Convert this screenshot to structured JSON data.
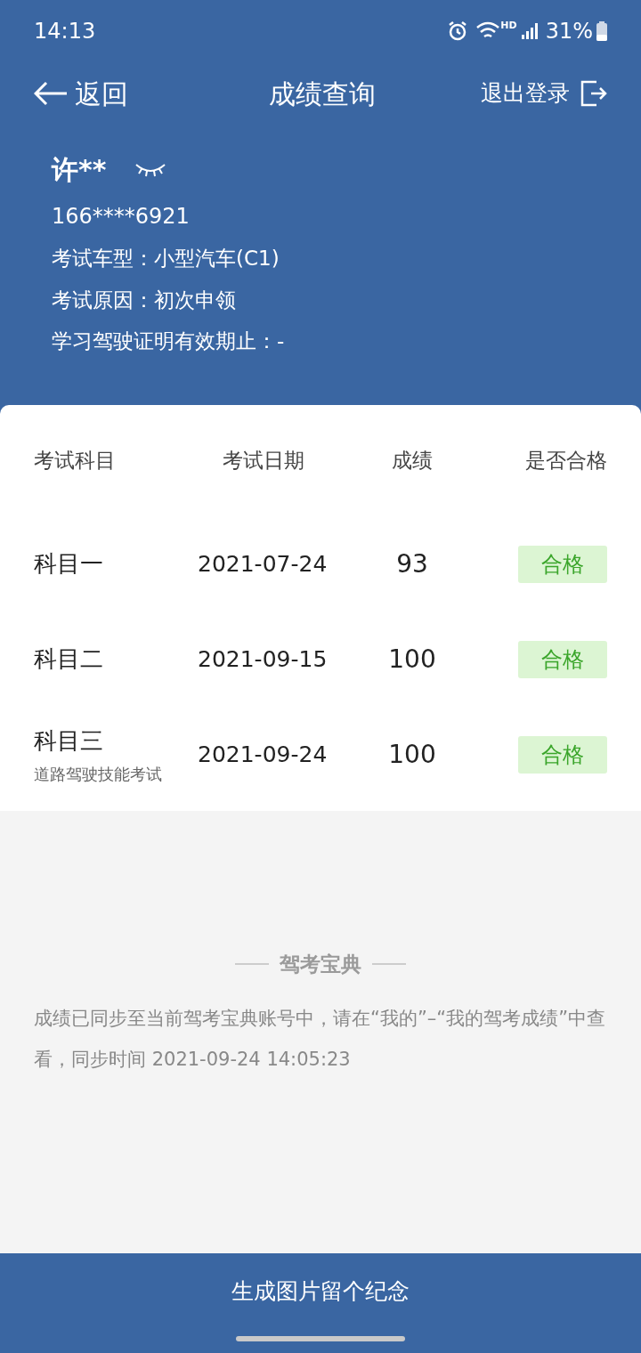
{
  "status_bar": {
    "time": "14:13",
    "network": "HD",
    "battery": "31%"
  },
  "nav": {
    "back": "返回",
    "title": "成绩查询",
    "logout": "退出登录"
  },
  "profile": {
    "name": "许**",
    "phone": "166****6921",
    "lines": [
      "考试车型：小型汽车(C1)",
      "考试原因：初次申领",
      "学习驾驶证明有效期止：-"
    ]
  },
  "table": {
    "columns": [
      "考试科目",
      "考试日期",
      "成绩",
      "是否合格"
    ],
    "rows": [
      {
        "subject": "科目一",
        "date": "2021-07-24",
        "score": "93",
        "result": "合格",
        "passed": true
      },
      {
        "subject": "科目二",
        "date": "2021-09-15",
        "score": "100",
        "result": "合格",
        "passed": true
      },
      {
        "subject": "科目三",
        "note": "道路驾驶技能考试",
        "date": "2021-09-24",
        "score": "100",
        "result": "合格",
        "passed": true
      }
    ]
  },
  "sync": {
    "brand": "驾考宝典",
    "message": "成绩已同步至当前驾考宝典账号中，请在“我的”–“我的驾考成绩”中查看，同步时间 2021-09-24 14:05:23"
  },
  "button": "生成图片留个纪念"
}
